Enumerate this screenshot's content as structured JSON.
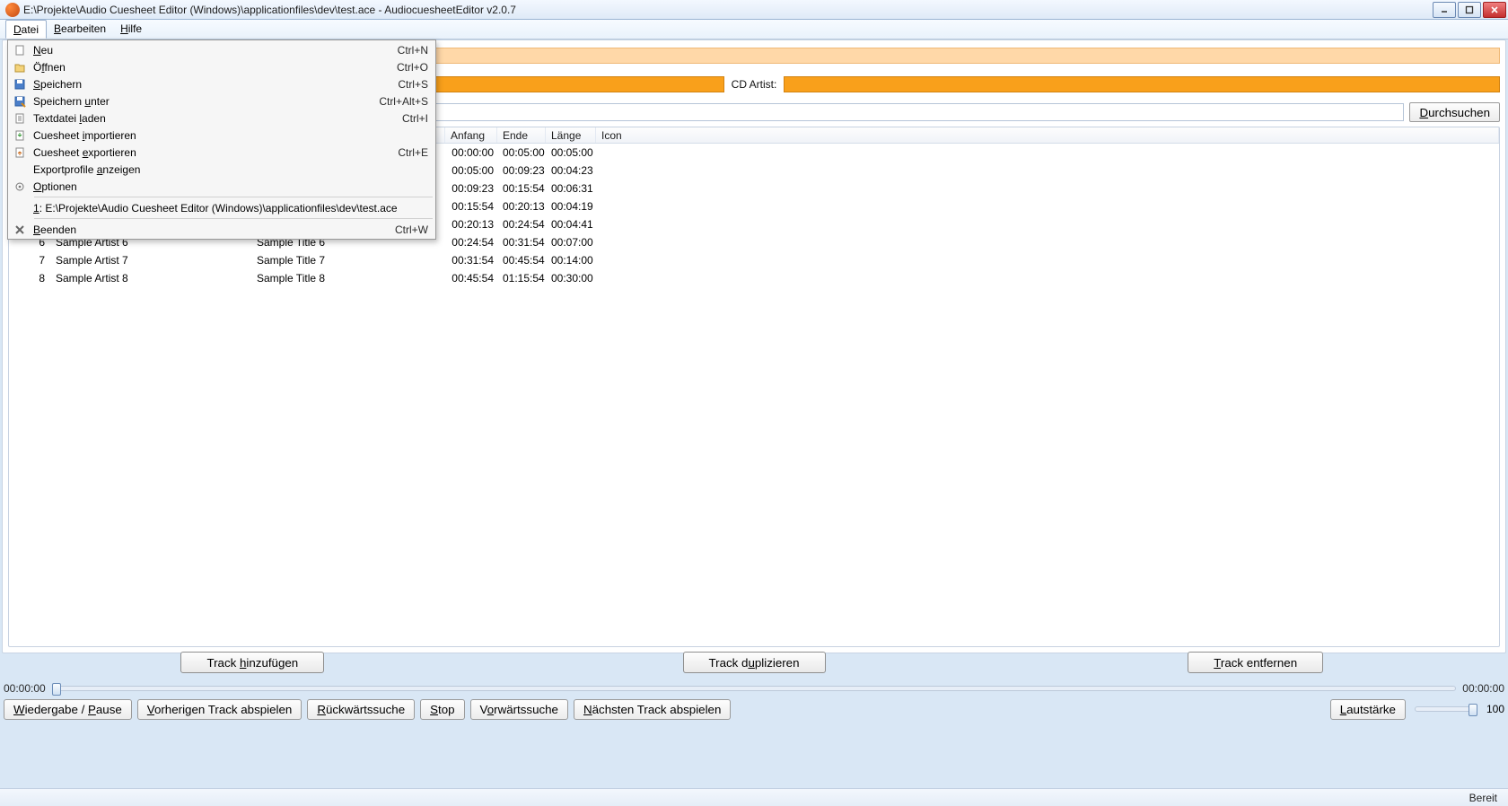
{
  "window": {
    "title": "E:\\Projekte\\Audio Cuesheet Editor (Windows)\\applicationfiles\\dev\\test.ace - AudiocuesheetEditor v2.0.7"
  },
  "menubar": {
    "datei": {
      "label_pre": "",
      "u": "D",
      "label_post": "atei"
    },
    "bearbeiten": {
      "label_pre": "",
      "u": "B",
      "label_post": "earbeiten"
    },
    "hilfe": {
      "label_pre": "",
      "u": "H",
      "label_post": "ilfe"
    }
  },
  "menu": {
    "items": [
      {
        "icon": "new-file-icon",
        "pre": "",
        "u": "N",
        "post": "eu",
        "accel": "Ctrl+N"
      },
      {
        "icon": "open-icon",
        "pre": "Ö",
        "u": "f",
        "post": "fnen",
        "accel": "Ctrl+O"
      },
      {
        "icon": "save-icon",
        "pre": "",
        "u": "S",
        "post": "peichern",
        "accel": "Ctrl+S"
      },
      {
        "icon": "save-as-icon",
        "pre": "Speichern ",
        "u": "u",
        "post": "nter",
        "accel": "Ctrl+Alt+S"
      },
      {
        "icon": "text-file-icon",
        "pre": "Textdatei ",
        "u": "l",
        "post": "aden",
        "accel": "Ctrl+I"
      },
      {
        "icon": "import-icon",
        "pre": "Cuesheet ",
        "u": "i",
        "post": "mportieren",
        "accel": ""
      },
      {
        "icon": "export-icon",
        "pre": "Cuesheet ",
        "u": "e",
        "post": "xportieren",
        "accel": "Ctrl+E"
      },
      {
        "icon": "",
        "pre": "Exportprofile ",
        "u": "a",
        "post": "nzeigen",
        "accel": ""
      },
      {
        "icon": "options-icon",
        "pre": "",
        "u": "O",
        "post": "ptionen",
        "accel": ""
      }
    ],
    "recent": {
      "pre": "",
      "u": "1",
      "post": ": E:\\Projekte\\Audio Cuesheet Editor (Windows)\\applicationfiles\\dev\\test.ace",
      "accel": ""
    },
    "quit": {
      "icon": "close-icon",
      "pre": "",
      "u": "B",
      "post": "eenden",
      "accel": "Ctrl+W"
    }
  },
  "fields": {
    "cd_artist_label": "CD Artist:",
    "browse_label": "Durchsuchen"
  },
  "table": {
    "headers": {
      "anfang": "Anfang",
      "ende": "Ende",
      "laenge": "Länge",
      "icon": "Icon"
    },
    "rows": [
      {
        "no": "",
        "artist": "",
        "title": "",
        "anfang": "00:00:00",
        "ende": "00:05:00",
        "laenge": "00:05:00"
      },
      {
        "no": "",
        "artist": "",
        "title": "",
        "anfang": "00:05:00",
        "ende": "00:09:23",
        "laenge": "00:04:23"
      },
      {
        "no": "",
        "artist": "",
        "title": "",
        "anfang": "00:09:23",
        "ende": "00:15:54",
        "laenge": "00:06:31"
      },
      {
        "no": "",
        "artist": "",
        "title": "",
        "anfang": "00:15:54",
        "ende": "00:20:13",
        "laenge": "00:04:19"
      },
      {
        "no": "",
        "artist": "",
        "title": "",
        "anfang": "00:20:13",
        "ende": "00:24:54",
        "laenge": "00:04:41"
      },
      {
        "no": "6",
        "artist": "Sample Artist 6",
        "title": "Sample Title 6",
        "anfang": "00:24:54",
        "ende": "00:31:54",
        "laenge": "00:07:00"
      },
      {
        "no": "7",
        "artist": "Sample Artist 7",
        "title": "Sample Title 7",
        "anfang": "00:31:54",
        "ende": "00:45:54",
        "laenge": "00:14:00"
      },
      {
        "no": "8",
        "artist": "Sample Artist 8",
        "title": "Sample Title 8",
        "anfang": "00:45:54",
        "ende": "01:15:54",
        "laenge": "00:30:00"
      }
    ]
  },
  "buttons": {
    "add": {
      "pre": "Track ",
      "u": "h",
      "post": "inzufügen"
    },
    "dup": {
      "pre": "Track d",
      "u": "u",
      "post": "plizieren"
    },
    "del": {
      "pre": "",
      "u": "T",
      "post": "rack entfernen"
    }
  },
  "seek": {
    "left": "00:00:00",
    "right": "00:00:00"
  },
  "playback": {
    "play": {
      "pre": "",
      "u": "W",
      "post": "iedergabe / ",
      "u2": "P",
      "post2": "ause"
    },
    "prev": {
      "pre": "",
      "u": "V",
      "post": "orherigen Track abspielen"
    },
    "rew": {
      "pre": "",
      "u": "R",
      "post": "ückwärtssuche"
    },
    "stop": {
      "pre": "",
      "u": "S",
      "post": "top"
    },
    "fwd": {
      "pre": "V",
      "u": "o",
      "post": "rwärtssuche"
    },
    "next": {
      "pre": "",
      "u": "N",
      "post": "ächsten Track abspielen"
    },
    "vol": {
      "pre": "",
      "u": "L",
      "post": "autstärke"
    },
    "vol_value": "100"
  },
  "status": {
    "ready": "Bereit"
  }
}
